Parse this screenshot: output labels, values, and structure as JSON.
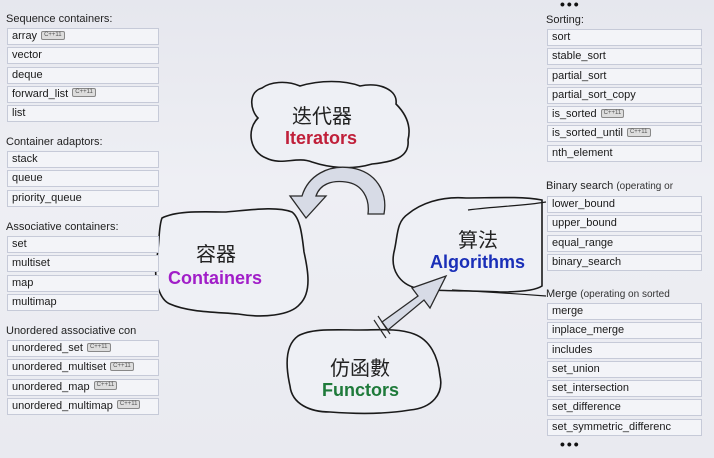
{
  "left": {
    "sequence": {
      "title": "Sequence containers:",
      "items": [
        {
          "label": "array",
          "badge": "C++11"
        },
        {
          "label": "vector",
          "badge": ""
        },
        {
          "label": "deque",
          "badge": ""
        },
        {
          "label": "forward_list",
          "badge": "C++11"
        },
        {
          "label": "list",
          "badge": ""
        }
      ]
    },
    "adaptors": {
      "title": "Container adaptors:",
      "items": [
        {
          "label": "stack",
          "badge": ""
        },
        {
          "label": "queue",
          "badge": ""
        },
        {
          "label": "priority_queue",
          "badge": ""
        }
      ]
    },
    "associative": {
      "title": "Associative containers:",
      "items": [
        {
          "label": "set",
          "badge": ""
        },
        {
          "label": "multiset",
          "badge": ""
        },
        {
          "label": "map",
          "badge": ""
        },
        {
          "label": "multimap",
          "badge": ""
        }
      ]
    },
    "unordered": {
      "title": "Unordered associative con",
      "items": [
        {
          "label": "unordered_set",
          "badge": "C++11"
        },
        {
          "label": "unordered_multiset",
          "badge": "C++11"
        },
        {
          "label": "unordered_map",
          "badge": "C++11"
        },
        {
          "label": "unordered_multimap",
          "badge": "C++11"
        }
      ]
    }
  },
  "right": {
    "top_dots": "•••",
    "bottom_dots": "•••",
    "sorting": {
      "title": "Sorting:",
      "items": [
        {
          "label": "sort",
          "badge": ""
        },
        {
          "label": "stable_sort",
          "badge": ""
        },
        {
          "label": "partial_sort",
          "badge": ""
        },
        {
          "label": "partial_sort_copy",
          "badge": ""
        },
        {
          "label": "is_sorted",
          "badge": "C++11"
        },
        {
          "label": "is_sorted_until",
          "badge": "C++11"
        },
        {
          "label": "nth_element",
          "badge": ""
        }
      ]
    },
    "binary": {
      "title": "Binary search",
      "title_note": "(operating or",
      "items": [
        {
          "label": "lower_bound",
          "badge": ""
        },
        {
          "label": "upper_bound",
          "badge": ""
        },
        {
          "label": "equal_range",
          "badge": ""
        },
        {
          "label": "binary_search",
          "badge": ""
        }
      ]
    },
    "merge": {
      "title": "Merge",
      "title_note": "(operating on sorted",
      "items": [
        {
          "label": "merge",
          "badge": ""
        },
        {
          "label": "inplace_merge",
          "badge": ""
        },
        {
          "label": "includes",
          "badge": ""
        },
        {
          "label": "set_union",
          "badge": ""
        },
        {
          "label": "set_intersection",
          "badge": ""
        },
        {
          "label": "set_difference",
          "badge": ""
        },
        {
          "label": "set_symmetric_differenc",
          "badge": ""
        }
      ]
    }
  },
  "diagram": {
    "iterators": {
      "cn": "迭代器",
      "en": "Iterators",
      "color": "#c0203a"
    },
    "containers": {
      "cn": "容器",
      "en": "Containers",
      "color": "#a11ec8"
    },
    "algorithms": {
      "cn": "算法",
      "en": "Algorithms",
      "color": "#1a2fb8"
    },
    "functors": {
      "cn": "仿函數",
      "en": "Functors",
      "color": "#1e7a3a"
    }
  }
}
